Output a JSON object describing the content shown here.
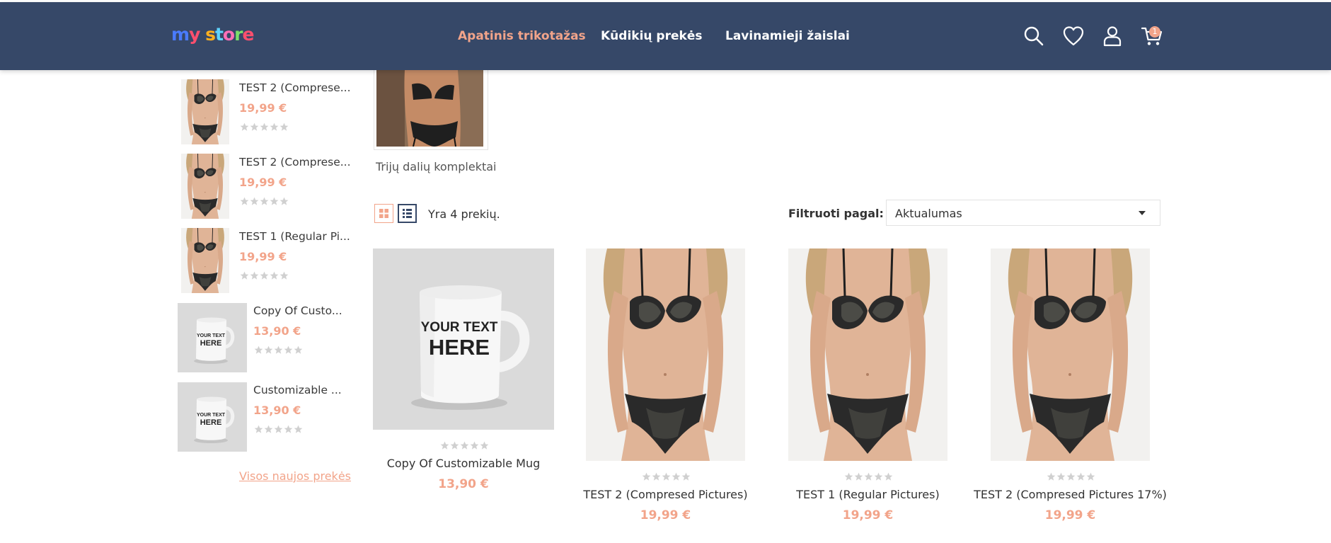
{
  "header": {
    "logo_text": "my store",
    "nav": [
      {
        "label": "Apatinis trikotažas",
        "active": true
      },
      {
        "label": "Kūdikių prekės",
        "active": false
      },
      {
        "label": "Lavinamieji žaislai",
        "active": false
      }
    ],
    "icons": [
      "search-icon",
      "heart-icon",
      "user-icon",
      "cart-icon"
    ],
    "cart_count": "1"
  },
  "sidebar": {
    "items": [
      {
        "name": "TEST 2 (Comprese...",
        "price": "19,99 €",
        "rating": 0,
        "image": "lingerie"
      },
      {
        "name": "TEST 2 (Comprese...",
        "price": "19,99 €",
        "rating": 0,
        "image": "lingerie"
      },
      {
        "name": "TEST 1 (Regular Pi...",
        "price": "19,99 €",
        "rating": 0,
        "image": "lingerie"
      },
      {
        "name": "Copy Of Custo...",
        "price": "13,90 €",
        "rating": 0,
        "image": "mug"
      },
      {
        "name": "Customizable ...",
        "price": "13,90 €",
        "rating": 0,
        "image": "mug"
      }
    ],
    "more_link": "Visos naujos prekės"
  },
  "subcategory": {
    "label": "Trijų dalių komplektai"
  },
  "toolbar": {
    "count_label": "Yra 4 prekių.",
    "sort_label": "Filtruoti pagal:",
    "sort_value": "Aktualumas"
  },
  "mug_text": {
    "line1": "YOUR TEXT",
    "line2": "HERE"
  },
  "products": [
    {
      "name": "Copy Of Customizable Mug",
      "price": "13,90 €",
      "rating": 0,
      "image": "mug"
    },
    {
      "name": "TEST 2 (Compresed Pictures)",
      "price": "19,99 €",
      "rating": 0,
      "image": "lingerie"
    },
    {
      "name": "TEST 1 (Regular Pictures)",
      "price": "19,99 €",
      "rating": 0,
      "image": "lingerie"
    },
    {
      "name": "TEST 2 (Compresed Pictures 17%)",
      "price": "19,99 €",
      "rating": 0,
      "image": "lingerie"
    }
  ],
  "colors": {
    "header_bg": "#364868",
    "accent": "#f2a48a",
    "star_empty": "#d0d0d0"
  }
}
